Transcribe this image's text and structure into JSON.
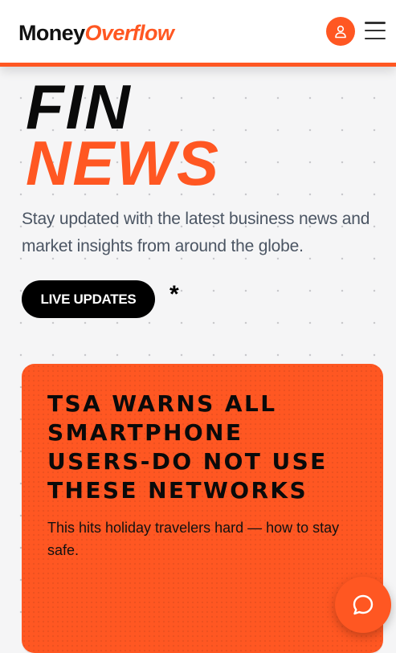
{
  "header": {
    "logo_part1": "Money",
    "logo_part2": "Overflow",
    "user_icon": "user-icon",
    "menu_icon": "hamburger-icon"
  },
  "hero": {
    "title_line1": "FIN",
    "title_line2": "NEWS",
    "subtitle": "Stay updated with the latest business news and market insights from around the globe.",
    "live_button_label": "LIVE UPDATES",
    "asterisk": "*"
  },
  "featured_card": {
    "title": "TSA WARNS ALL SMARTPHONE USERS-DO NOT USE THESE NETWORKS",
    "description": "This hits holiday travelers hard — how to stay safe."
  },
  "chat": {
    "icon": "chat-bubble-icon"
  },
  "colors": {
    "accent": "#ff5722",
    "text_dark": "#0a0a0a",
    "subtitle_gray": "#4b5563",
    "background": "#f5f5f6"
  }
}
